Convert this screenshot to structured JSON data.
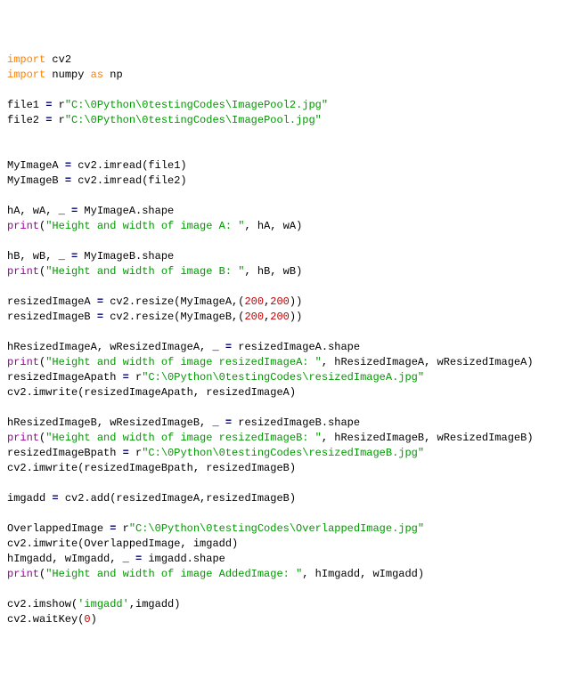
{
  "code": {
    "l1": {
      "t1": "import",
      "t2": " cv2"
    },
    "l2": {
      "t1": "import",
      "t2": " numpy ",
      "t3": "as",
      "t4": " np"
    },
    "l3": {
      "t1": "file1 ",
      "t2": "=",
      "t3": " r",
      "t4": "\"C:\\0Python\\0testingCodes\\ImagePool2.jpg\""
    },
    "l4": {
      "t1": "file2 ",
      "t2": "=",
      "t3": " r",
      "t4": "\"C:\\0Python\\0testingCodes\\ImagePool.jpg\""
    },
    "l5": {
      "t1": "MyImageA ",
      "t2": "=",
      "t3": " cv2.imread(file1)"
    },
    "l6": {
      "t1": "MyImageB ",
      "t2": "=",
      "t3": " cv2.imread(file2)"
    },
    "l7": {
      "t1": "hA, wA, _ ",
      "t2": "=",
      "t3": " MyImageA.shape"
    },
    "l8": {
      "t1": "print",
      "t2": "(",
      "t3": "\"Height and width of image A: \"",
      "t4": ", hA, wA)"
    },
    "l9": {
      "t1": "hB, wB, _ ",
      "t2": "=",
      "t3": " MyImageB.shape"
    },
    "l10": {
      "t1": "print",
      "t2": "(",
      "t3": "\"Height and width of image B: \"",
      "t4": ", hB, wB)"
    },
    "l11": {
      "t1": "resizedImageA ",
      "t2": "=",
      "t3": " cv2.resize(MyImageA,(",
      "t4": "200",
      "t5": ",",
      "t6": "200",
      "t7": "))"
    },
    "l12": {
      "t1": "resizedImageB ",
      "t2": "=",
      "t3": " cv2.resize(MyImageB,(",
      "t4": "200",
      "t5": ",",
      "t6": "200",
      "t7": "))"
    },
    "l13": {
      "t1": "hResizedImageA, wResizedImageA, _ ",
      "t2": "=",
      "t3": " resizedImageA.shape"
    },
    "l14": {
      "t1": "print",
      "t2": "(",
      "t3": "\"Height and width of image resizedImageA: \"",
      "t4": ", hResizedImageA, wResizedImageA)"
    },
    "l15": {
      "t1": "resizedImageApath ",
      "t2": "=",
      "t3": " r",
      "t4": "\"C:\\0Python\\0testingCodes\\resizedImageA.jpg\""
    },
    "l16": {
      "t1": "cv2.imwrite(resizedImageApath, resizedImageA)"
    },
    "l17": {
      "t1": "hResizedImageB, wResizedImageB, _ ",
      "t2": "=",
      "t3": " resizedImageB.shape"
    },
    "l18": {
      "t1": "print",
      "t2": "(",
      "t3": "\"Height and width of image resizedImageB: \"",
      "t4": ", hResizedImageB, wResizedImageB)"
    },
    "l19": {
      "t1": "resizedImageBpath ",
      "t2": "=",
      "t3": " r",
      "t4": "\"C:\\0Python\\0testingCodes\\resizedImageB.jpg\""
    },
    "l20": {
      "t1": "cv2.imwrite(resizedImageBpath, resizedImageB)"
    },
    "l21": {
      "t1": "imgadd ",
      "t2": "=",
      "t3": " cv2.add(resizedImageA,resizedImageB)"
    },
    "l22": {
      "t1": "OverlappedImage ",
      "t2": "=",
      "t3": " r",
      "t4": "\"C:\\0Python\\0testingCodes\\OverlappedImage.jpg\""
    },
    "l23": {
      "t1": "cv2.imwrite(OverlappedImage, imgadd)"
    },
    "l24": {
      "t1": "hImgadd, wImgadd, _ ",
      "t2": "=",
      "t3": " imgadd.shape"
    },
    "l25": {
      "t1": "print",
      "t2": "(",
      "t3": "\"Height and width of image AddedImage: \"",
      "t4": ", hImgadd, wImgadd)"
    },
    "l26": {
      "t1": "cv2.imshow(",
      "t2": "'imgadd'",
      "t3": ",imgadd)"
    },
    "l27": {
      "t1": "cv2.waitKey(",
      "t2": "0",
      "t3": ")"
    }
  }
}
